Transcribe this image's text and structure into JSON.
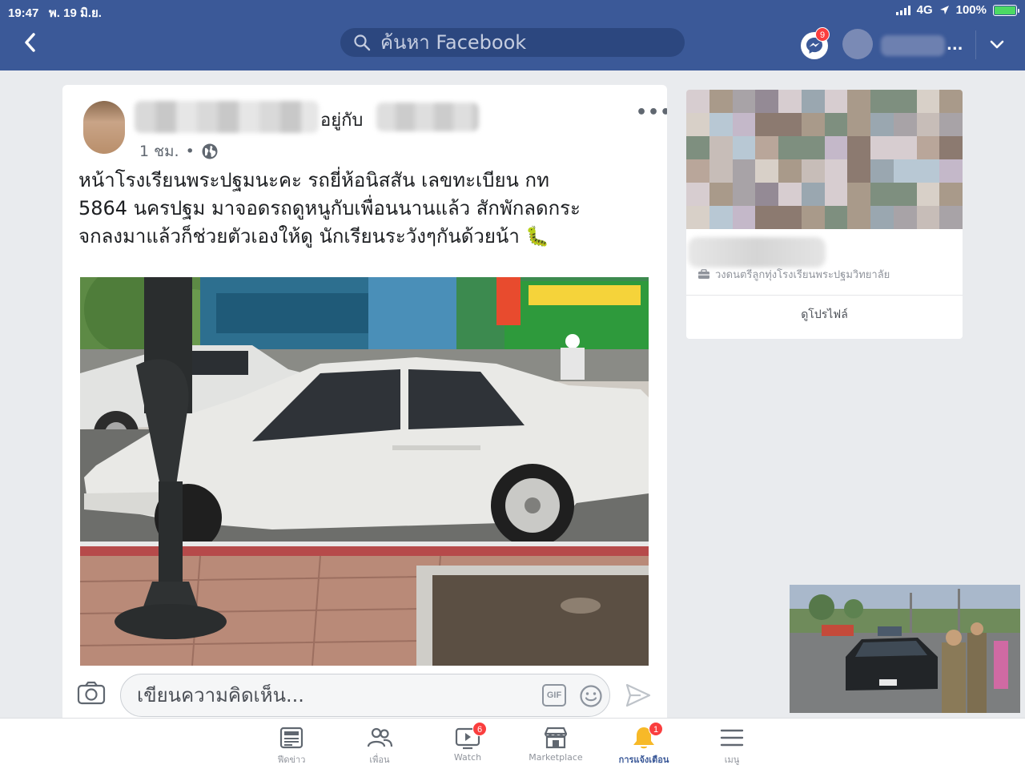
{
  "status_bar": {
    "time": "19:47",
    "date": "พ. 19 มิ.ย.",
    "network": "4G",
    "battery": "100%"
  },
  "nav": {
    "search_placeholder": "ค้นหา Facebook",
    "messenger_badge": "9",
    "name_suffix": "..."
  },
  "post": {
    "author_connector": "อยู่กับ",
    "time": "1 ชม.",
    "dot": "•",
    "menu_label": "•••",
    "text_line1": "หน้าโรงเรียนพระปฐมนะคะ รถยี่ห้อนิสสัน เลขทะเบียน กท",
    "text_line2": "5864 นครปฐม มาจอดรถดูหนูกับเพื่อนนานแล้ว สักพักลดกระ",
    "text_line3": "จกลงมาแล้วก็ช่วยตัวเองให้ดู นักเรียนระวังๆกันด้วยน้า 🐛",
    "comment_placeholder": "เขียนความคิดเห็น...",
    "gif_label": "GIF"
  },
  "profile_card": {
    "work": "วงดนตรีลูกทุ่งโรงเรียนพระปฐมวิทยาลัย",
    "button": "ดูโปรไฟล์"
  },
  "tabs": [
    {
      "label": "ฟีดข่าว",
      "icon": "news-feed-icon",
      "badge": ""
    },
    {
      "label": "เพื่อน",
      "icon": "friends-icon",
      "badge": ""
    },
    {
      "label": "Watch",
      "icon": "watch-icon",
      "badge": "6"
    },
    {
      "label": "Marketplace",
      "icon": "marketplace-icon",
      "badge": ""
    },
    {
      "label": "การแจ้งเตือน",
      "icon": "bell-icon",
      "badge": "1"
    },
    {
      "label": "เมนู",
      "icon": "menu-icon",
      "badge": ""
    }
  ],
  "colors": {
    "brand": "#3b5998",
    "badge": "#fa3e3e",
    "background": "#e9ebee",
    "notification_active": "#f7b928"
  }
}
